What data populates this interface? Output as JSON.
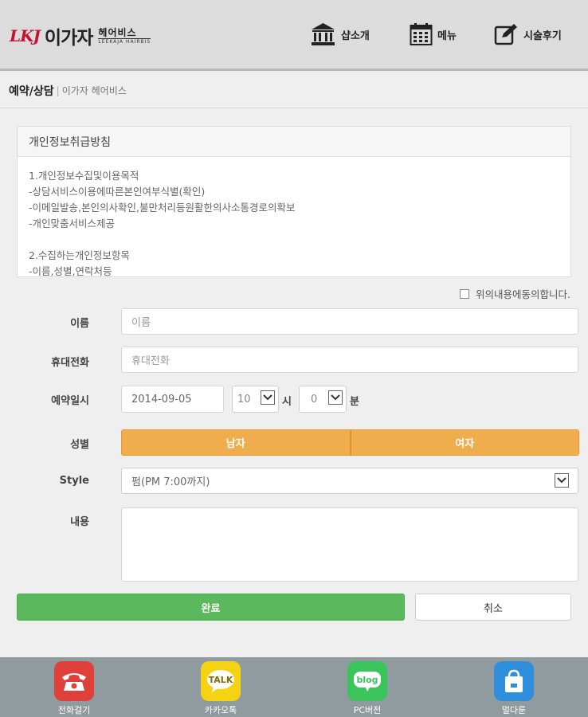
{
  "header": {
    "logo_mark": "LKJ",
    "logo_name": "이가자",
    "logo_sub_ko": "헤어비스",
    "logo_sub_en": "LEEKAJA HAIRBIS",
    "nav": [
      {
        "label": "샵소개",
        "icon": "building-icon"
      },
      {
        "label": "메뉴",
        "icon": "calendar-icon"
      },
      {
        "label": "시술후기",
        "icon": "edit-icon"
      }
    ]
  },
  "titlebar": {
    "title": "예약/상담",
    "separator": "|",
    "subtitle": "이가자 헤어비스"
  },
  "policy": {
    "heading": "개인정보취급방침",
    "lines": [
      "1.개인정보수집및이용목적",
      "-상담서비스이용에따른본인여부식별(확인)",
      "-이메일발송,본인의사확인,불만처리등원활한의사소통경로의확보",
      "-개인맞춤서비스제공",
      "",
      "2.수집하는개인정보항목",
      "-이름,성별,연락처등"
    ]
  },
  "agree": {
    "label": "위의내용에동의합니다.",
    "checked": false
  },
  "form": {
    "name": {
      "label": "이름",
      "placeholder": "이름"
    },
    "phone": {
      "label": "휴대전화",
      "placeholder": "휴대전화"
    },
    "datetime": {
      "label": "예약일시",
      "date": "2014-09-05",
      "hour": "10",
      "hour_unit": "시",
      "minute": "0",
      "minute_unit": "분"
    },
    "gender": {
      "label": "성별",
      "male": "남자",
      "female": "여자"
    },
    "style": {
      "label": "Style",
      "selected": "펌(PM 7:00까지)"
    },
    "content": {
      "label": "내용"
    }
  },
  "buttons": {
    "submit": "완료",
    "cancel": "취소"
  },
  "footer": {
    "items": [
      {
        "label": "전화걸기",
        "icon": "phone-icon",
        "color": "#e0403a"
      },
      {
        "label": "카카오톡",
        "icon": "kakaotalk-icon",
        "color": "#f5d313"
      },
      {
        "label": "PC버전",
        "icon": "blog-icon",
        "color": "#3cc45c"
      },
      {
        "label": "멀다룬",
        "icon": "shopping-bag-icon",
        "color": "#2f8fdc"
      }
    ]
  },
  "colors": {
    "accent_orange": "#f0ad4e",
    "submit_green": "#5cb85c",
    "brand_red": "#c8102e"
  }
}
